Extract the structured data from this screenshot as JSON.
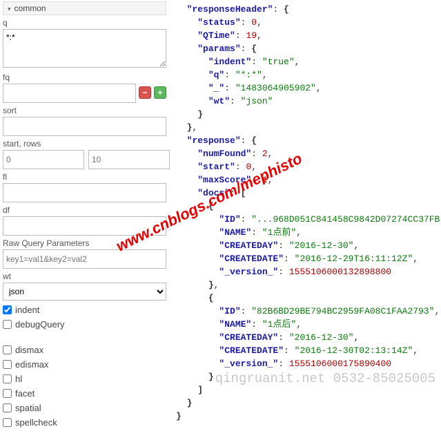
{
  "left": {
    "section": "common",
    "q_label": "q",
    "q_value": "*:*",
    "fq_label": "fq",
    "sort_label": "sort",
    "startrows_label": "start, rows",
    "start_placeholder": "0",
    "rows_placeholder": "10",
    "fl_label": "fl",
    "df_label": "df",
    "raw_label": "Raw Query Parameters",
    "raw_placeholder": "key1=val1&key2=val2",
    "wt_label": "wt",
    "wt_value": "json",
    "indent_label": "indent",
    "indent_checked": true,
    "debug_label": "debugQuery",
    "dismax_label": "dismax",
    "edismax_label": "edismax",
    "hl_label": "hl",
    "facet_label": "facet",
    "spatial_label": "spatial",
    "spellcheck_label": "spellcheck",
    "minus": "−",
    "plus": "+"
  },
  "chart_data": {
    "type": "table",
    "responseHeader": {
      "status": 0,
      "QTime": 19,
      "params": {
        "indent": "true",
        "q": "*:*",
        "_": "1483064905902",
        "wt": "json"
      }
    },
    "response": {
      "numFound": 2,
      "start": 0,
      "maxScore": 1,
      "docs": [
        {
          "ID": "...968D051C841458C9842D07274CC37FB",
          "NAME": "1点前",
          "CREATEDAY": "2016-12-30",
          "CREATEDATE": "2016-12-29T16:11:12Z",
          "_version_": 1555106000132898800
        },
        {
          "ID": "82B6BD29BE794BC2959FA08C1FAA2793",
          "NAME": "1点后",
          "CREATEDAY": "2016-12-30",
          "CREATEDATE": "2016-12-30T02:13:14Z",
          "_version_": 1555106000175890400
        }
      ]
    }
  },
  "watermark1": "www.cnblogs.com/mephisto",
  "watermark2": "qingruanit.net 0532-85025005"
}
